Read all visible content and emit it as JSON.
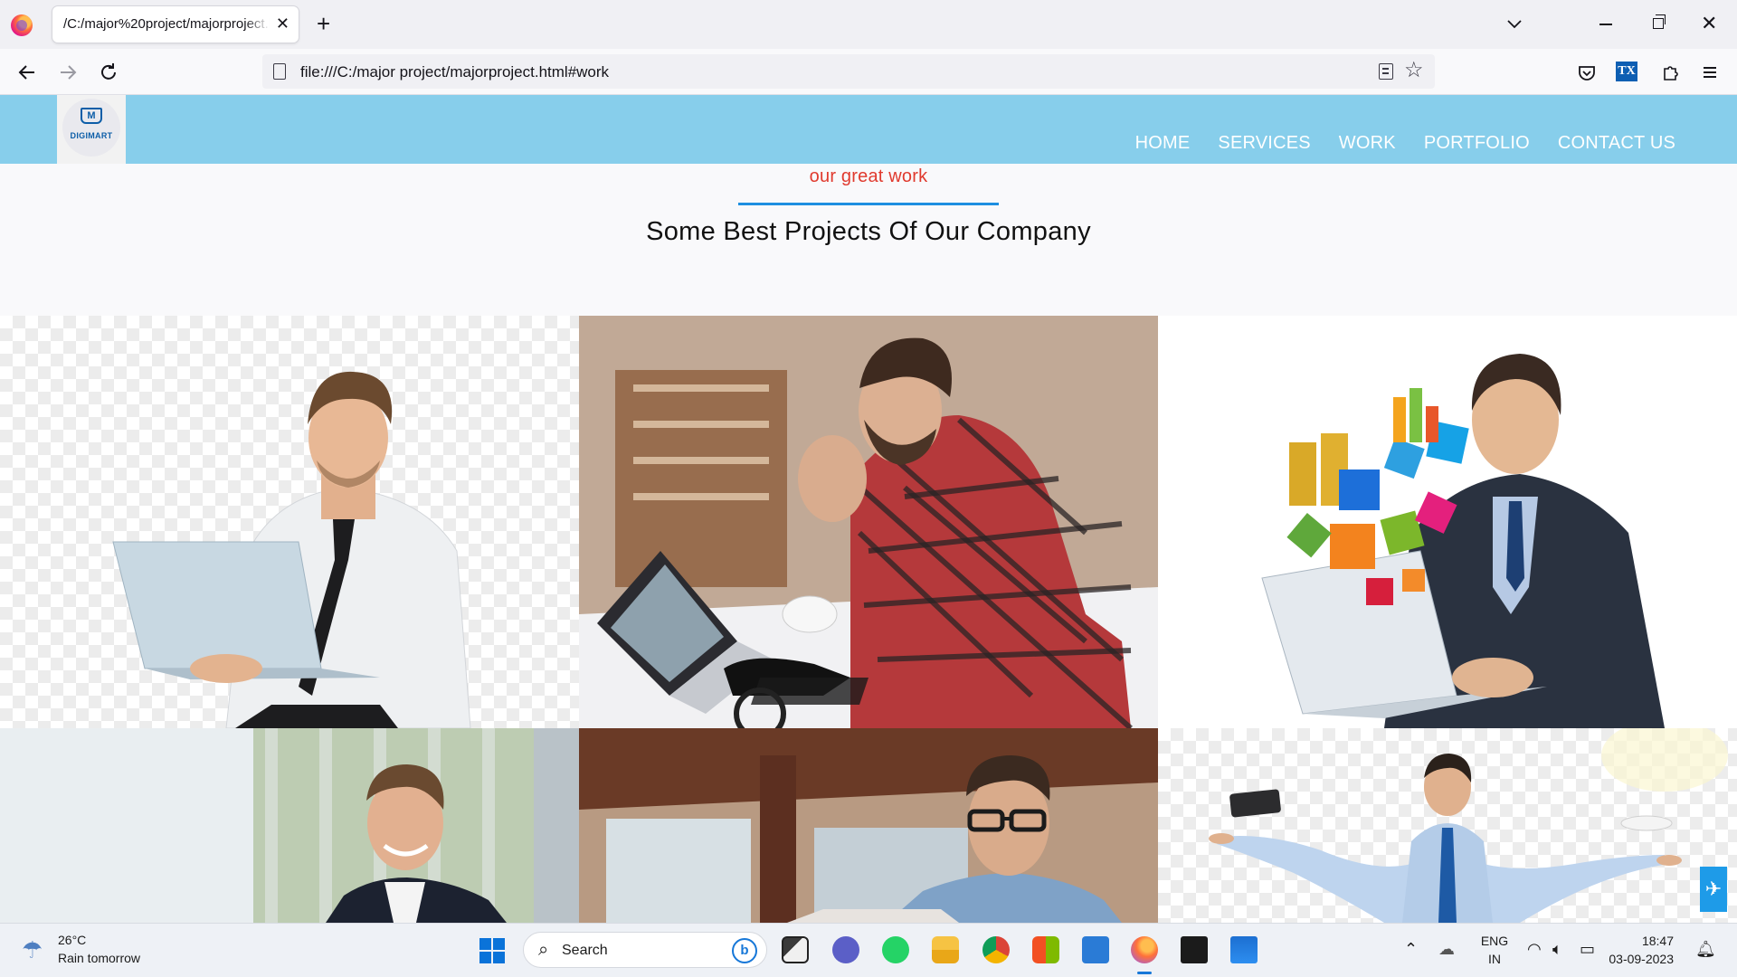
{
  "browser": {
    "tab_title": "/C:/major%20project/majorproject.html#work",
    "tab_close": "✕",
    "new_tab": "+",
    "url": "file:///C:/major project/majorproject.html#work",
    "icons": [
      "firefox-icon",
      "back-icon",
      "forward-icon",
      "reload-icon",
      "reader-view-icon",
      "bookmark-star-icon",
      "pocket-icon",
      "extensions-icon",
      "menu-icon"
    ],
    "tx_extension_label": "TX"
  },
  "site": {
    "logo_text": "DIGIMART",
    "logo_mark": "M",
    "nav": [
      "HOME",
      "SERVICES",
      "WORK",
      "PORTFOLIO",
      "CONTACT US"
    ],
    "section_subtitle": "our great work",
    "section_title": "Some Best Projects Of Our Company",
    "colors": {
      "header_bg": "#87ceeb",
      "accent_red": "#e03a2e",
      "underline_blue": "#1e8fe1"
    }
  },
  "taskbar": {
    "weather_temp": "26°C",
    "weather_desc": "Rain tomorrow",
    "search_label": "Search",
    "bing_label": "b",
    "language_line1": "ENG",
    "language_line2": "IN",
    "time": "18:47",
    "date": "03-09-2023"
  }
}
